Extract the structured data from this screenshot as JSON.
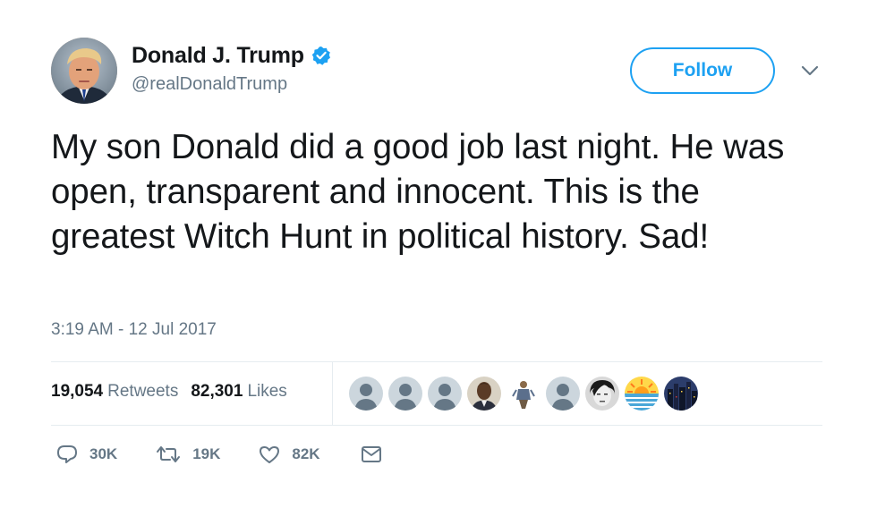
{
  "user": {
    "display_name": "Donald J. Trump",
    "handle": "@realDonaldTrump",
    "verified": true,
    "avatar_icon": "profile-photo"
  },
  "header": {
    "follow_label": "Follow",
    "caret_icon": "chevron-down-icon"
  },
  "tweet": {
    "text": "My son Donald did a good job last night. He was open, transparent and innocent. This is the greatest Witch Hunt in political history. Sad!",
    "timestamp": "3:19 AM - 12 Jul 2017"
  },
  "stats": {
    "retweets_count": "19,054",
    "retweets_label": "Retweets",
    "likes_count": "82,301",
    "likes_label": "Likes"
  },
  "likers": [
    {
      "kind": "default-egg"
    },
    {
      "kind": "default-egg"
    },
    {
      "kind": "default-egg"
    },
    {
      "kind": "photo-person"
    },
    {
      "kind": "photo-figure"
    },
    {
      "kind": "default-egg"
    },
    {
      "kind": "photo-bw-face"
    },
    {
      "kind": "photo-sunset"
    },
    {
      "kind": "photo-city"
    }
  ],
  "actions": {
    "reply_count": "30K",
    "retweet_count": "19K",
    "like_count": "82K",
    "reply_icon": "reply-icon",
    "retweet_icon": "retweet-icon",
    "like_icon": "heart-icon",
    "dm_icon": "envelope-icon"
  },
  "colors": {
    "accent": "#1da1f2",
    "secondary_text": "#657786",
    "primary_text": "#14171a",
    "divider": "#e6ecf0"
  }
}
